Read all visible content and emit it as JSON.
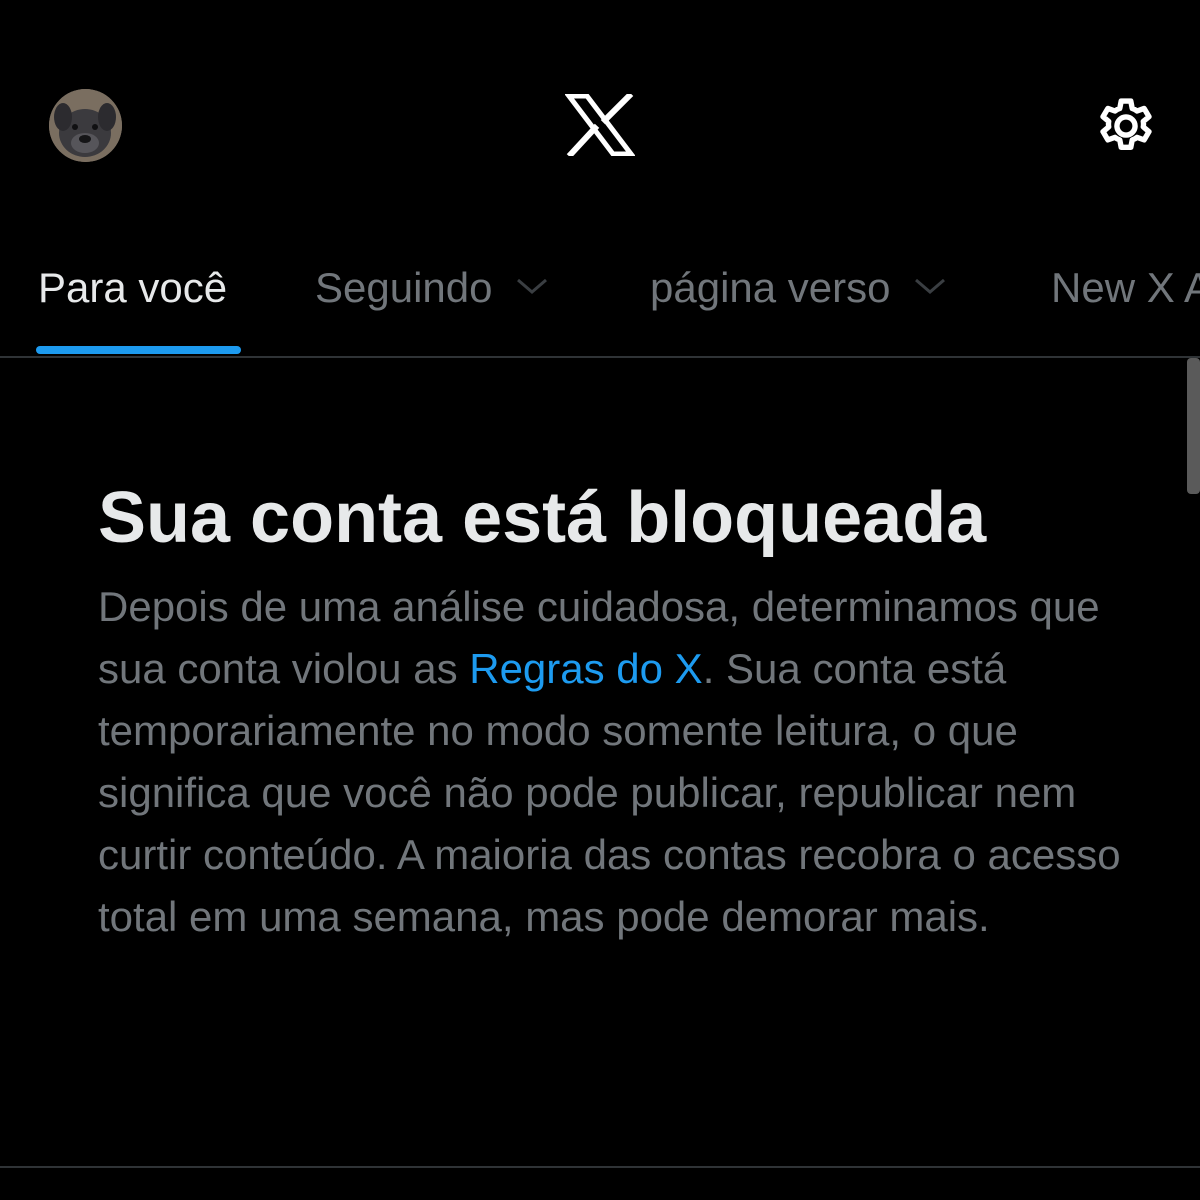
{
  "header": {
    "logo_icon": "x-logo-icon",
    "settings_icon": "gear-icon",
    "avatar_icon": "dog-avatar"
  },
  "tabs": [
    {
      "label": "Para você",
      "active": true,
      "dropdown": false
    },
    {
      "label": "Seguindo",
      "active": false,
      "dropdown": true
    },
    {
      "label": "página verso",
      "active": false,
      "dropdown": true
    },
    {
      "label": "New X A",
      "active": false,
      "dropdown": false
    }
  ],
  "notice": {
    "title": "Sua conta está bloqueada",
    "body_before_link": "Depois de uma análise cuidadosa, determinamos que sua conta violou as ",
    "link_text": "Regras do X",
    "body_after_link": ". Sua conta está temporariamente no modo somente leitura, o que significa que você não pode publicar, republicar nem curtir conteúdo. A maioria das contas recobra o acesso total em uma semana, mas pode demorar mais."
  },
  "colors": {
    "background": "#000000",
    "primary_text": "#e7e9ea",
    "secondary_text": "#71767b",
    "accent": "#1d9bf0",
    "divider": "#2f3336"
  }
}
